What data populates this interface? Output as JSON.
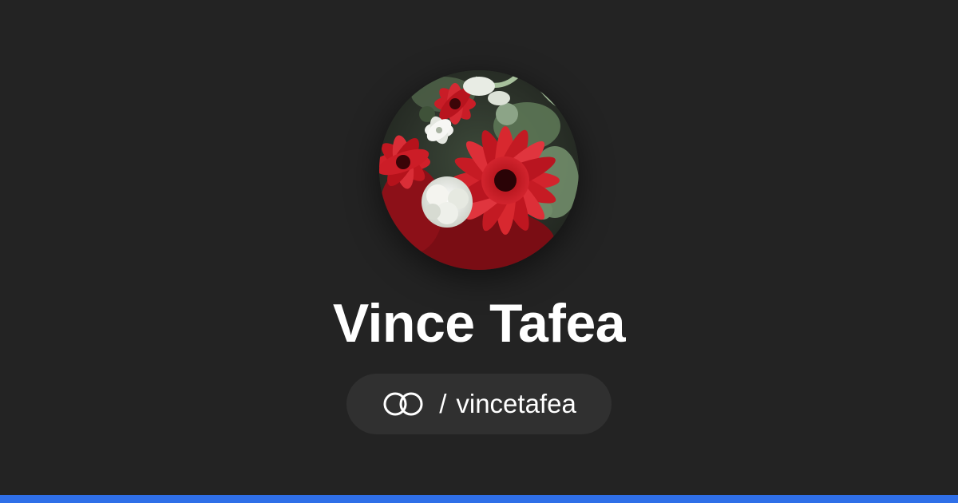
{
  "profile": {
    "name": "Vince Tafea",
    "separator": "/",
    "handle": "vincetafea",
    "avatar_icon": "flower-bouquet-photo",
    "link_icon": "linked-rings-icon"
  },
  "colors": {
    "background": "#232323",
    "pill": "#303030",
    "accent_bar": "#2f6fe8",
    "text": "#ffffff"
  }
}
